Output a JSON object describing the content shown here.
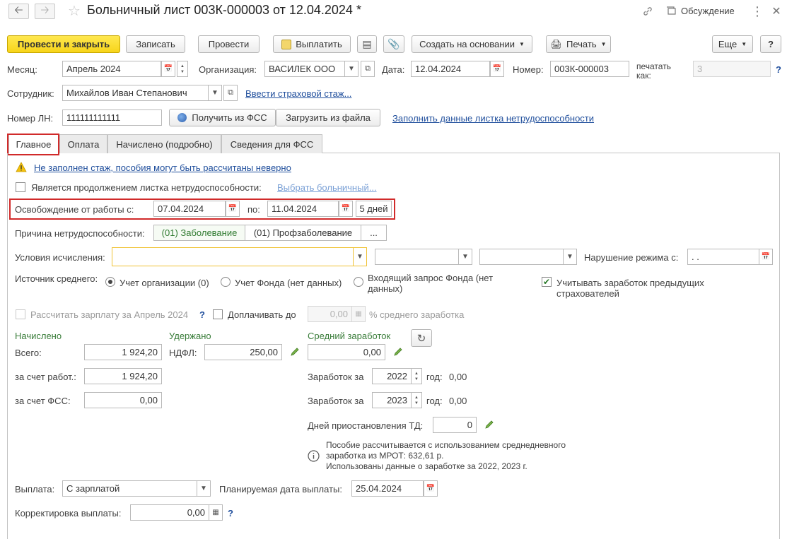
{
  "header": {
    "title": "Больничный лист 003К-000003 от 12.04.2024 *",
    "discussion": "Обсуждение"
  },
  "toolbar": {
    "post_close": "Провести и закрыть",
    "save": "Записать",
    "post": "Провести",
    "pay": "Выплатить",
    "create_based": "Создать на основании",
    "print": "Печать",
    "more": "Еще",
    "help": "?"
  },
  "form": {
    "month_label": "Месяц:",
    "month_value": "Апрель 2024",
    "org_label": "Организация:",
    "org_value": "ВАСИЛЕК ООО",
    "date_label": "Дата:",
    "date_value": "12.04.2024",
    "number_label": "Номер:",
    "number_value": "003К-000003",
    "print_as_label": "печатать как:",
    "print_as_value": "3",
    "help": "?",
    "employee_label": "Сотрудник:",
    "employee_value": "Михайлов Иван Степанович",
    "insurance_link": "Ввести страховой стаж...",
    "ln_label": "Номер ЛН:",
    "ln_value": "111111111111",
    "get_fss": "Получить из ФСС",
    "load_file": "Загрузить из файла",
    "fill_link": "Заполнить данные листка нетрудоспособности"
  },
  "tabs": [
    "Главное",
    "Оплата",
    "Начислено (подробно)",
    "Сведения для ФСС"
  ],
  "main": {
    "warning_link": "Не заполнен стаж, пособия могут быть рассчитаны неверно",
    "continuation_label": "Является продолжением листка нетрудоспособности:",
    "choose_sick_link": "Выбрать больничный...",
    "release_label": "Освобождение от работы с:",
    "release_from": "07.04.2024",
    "to_label": "по:",
    "release_to": "11.04.2024",
    "days": "5 дней",
    "cause_label": "Причина нетрудоспособности:",
    "cause_1": "(01) Заболевание",
    "cause_2": "(01) Профзаболевание",
    "cause_more": "...",
    "conditions_label": "Условия исчисления:",
    "conditions_value": "",
    "regime_label": "Нарушение режима с:",
    "regime_value": " .  .",
    "source_label": "Источник среднего:",
    "source_org": "Учет организации (0)",
    "source_fund": "Учет Фонда (нет данных)",
    "source_incoming_1": "Входящий запрос Фонда (нет",
    "source_incoming_2": "данных)",
    "prev_earnings_1": "Учитывать заработок предыдущих",
    "prev_earnings_2": "страхователей",
    "calc_salary": "Рассчитать зарплату за Апрель 2024",
    "calc_help": "?",
    "top_up_label": "Доплачивать до",
    "top_up_value": "0,00",
    "top_up_suffix": "% среднего заработка",
    "accrued_header": "Начислено",
    "withheld_header": "Удержано",
    "avg_header": "Средний заработок",
    "total_label": "Всего:",
    "total_value": "1 924,20",
    "ndfl_label": "НДФЛ:",
    "ndfl_value": "250,00",
    "avg_value": "0,00",
    "employer_label": "за счет работ.:",
    "employer_value": "1 924,20",
    "fss_label": "за счет ФСС:",
    "fss_value": "0,00",
    "earn_label_1": "Заработок за",
    "earn_year_1": "2022",
    "earn_year_label_1": "год:",
    "earn_value_1": "0,00",
    "earn_label_2": "Заработок за",
    "earn_year_2": "2023",
    "earn_year_label_2": "год:",
    "earn_value_2": "0,00",
    "suspend_label": "Дней приостановления ТД:",
    "suspend_value": "0",
    "info_1": "Пособие рассчитывается с использованием среднедневного",
    "info_2": "заработка из МРОТ: 632,61 р.",
    "info_3": "Использованы данные о заработке за  2022,  2023 г.",
    "payout_label": "Выплата:",
    "payout_value": "С зарплатой",
    "plan_date_label": "Планируемая дата выплаты:",
    "plan_date_value": "25.04.2024",
    "correction_label": "Корректировка выплаты:",
    "correction_value": "0,00",
    "correction_help": "?"
  }
}
